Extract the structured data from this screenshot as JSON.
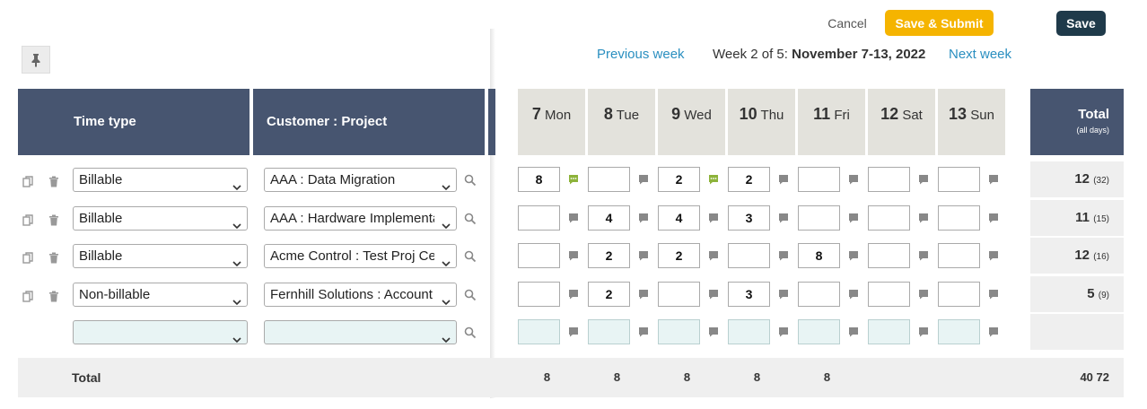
{
  "toolbar": {
    "cancel_label": "Cancel",
    "submit_label": "Save & Submit",
    "save_label": "Save"
  },
  "week_nav": {
    "prev_label": "Previous week",
    "week_prefix": "Week 2 of 5:",
    "week_range": "November 7-13, 2022",
    "next_label": "Next week"
  },
  "columns": {
    "time_type": "Time type",
    "customer_project": "Customer : Project",
    "total": "Total",
    "total_sub": "(all days)"
  },
  "days": [
    {
      "num": "7",
      "name": "Mon"
    },
    {
      "num": "8",
      "name": "Tue"
    },
    {
      "num": "9",
      "name": "Wed"
    },
    {
      "num": "10",
      "name": "Thu"
    },
    {
      "num": "11",
      "name": "Fri"
    },
    {
      "num": "12",
      "name": "Sat"
    },
    {
      "num": "13",
      "name": "Sun"
    }
  ],
  "rows": [
    {
      "time_type": "Billable",
      "project": "AAA : Data Migration",
      "hours": [
        "8",
        "",
        "2",
        "2",
        "",
        "",
        ""
      ],
      "comments": [
        true,
        false,
        true,
        false,
        false,
        false,
        false
      ],
      "total": "12",
      "total_all": "(32)"
    },
    {
      "time_type": "Billable",
      "project": "AAA : Hardware Implementation",
      "hours": [
        "",
        "4",
        "4",
        "3",
        "",
        "",
        ""
      ],
      "comments": [
        false,
        false,
        false,
        false,
        false,
        false,
        false
      ],
      "total": "11",
      "total_all": "(15)"
    },
    {
      "time_type": "Billable",
      "project": "Acme Control : Test Proj Center",
      "hours": [
        "",
        "2",
        "2",
        "",
        "8",
        "",
        ""
      ],
      "comments": [
        false,
        false,
        false,
        false,
        false,
        false,
        false
      ],
      "total": "12",
      "total_all": "(16)"
    },
    {
      "time_type": "Non-billable",
      "project": "Fernhill Solutions : Account review",
      "hours": [
        "",
        "2",
        "",
        "3",
        "",
        "",
        ""
      ],
      "comments": [
        false,
        false,
        false,
        false,
        false,
        false,
        false
      ],
      "total": "5",
      "total_all": "(9)"
    }
  ],
  "footer": {
    "label": "Total",
    "day_totals": [
      "8",
      "8",
      "8",
      "8",
      "8",
      "",
      ""
    ],
    "grand_total": "40 72"
  },
  "colors": {
    "header": "#475570",
    "day_header": "#e3e2dc",
    "submit": "#f5b400",
    "save": "#1f3a4a",
    "link": "#2a8fc0",
    "comment_active": "#8db33a"
  }
}
